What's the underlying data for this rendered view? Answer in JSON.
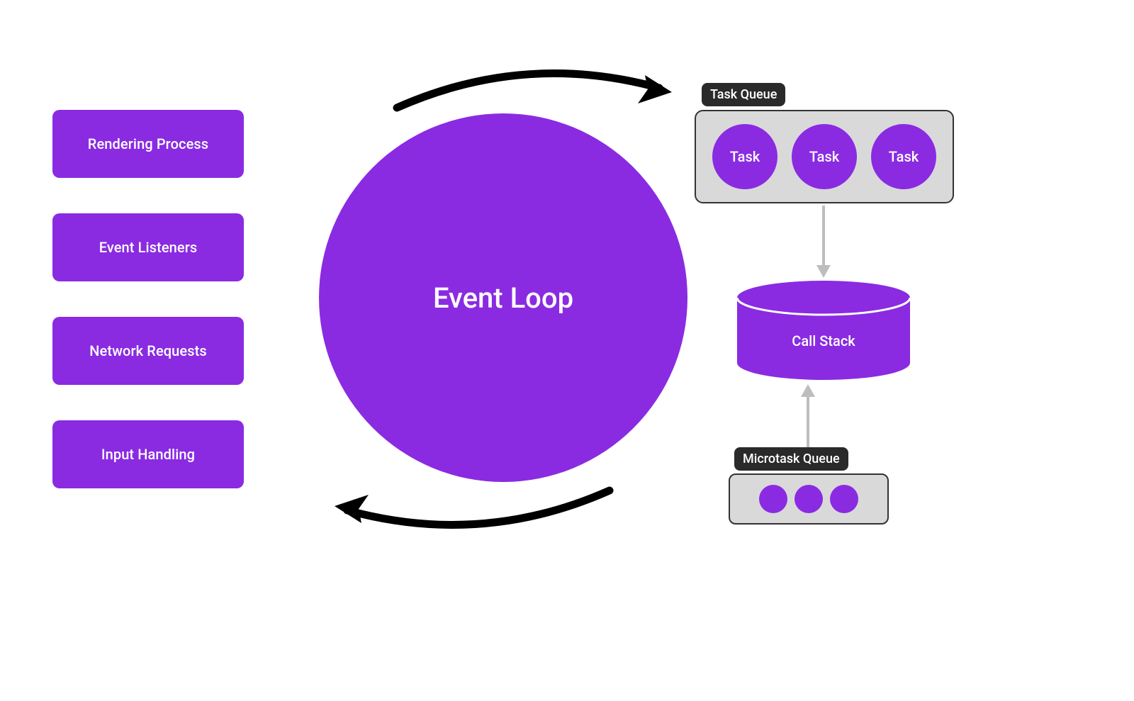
{
  "colors": {
    "purple": "#8a2be2",
    "box_bg": "#d9d9d9",
    "label_bg": "#2a2a2a",
    "arrow_black": "#000000",
    "arrow_grey": "#bdbdbd"
  },
  "left_items": [
    {
      "label": "Rendering Process"
    },
    {
      "label": "Event Listeners"
    },
    {
      "label": "Network Requests"
    },
    {
      "label": "Input Handling"
    }
  ],
  "center": {
    "label": "Event Loop"
  },
  "task_queue": {
    "title": "Task Queue",
    "tasks": [
      {
        "label": "Task"
      },
      {
        "label": "Task"
      },
      {
        "label": "Task"
      }
    ]
  },
  "call_stack": {
    "label": "Call Stack"
  },
  "microtask_queue": {
    "title": "Microtask Queue",
    "count": 3
  }
}
